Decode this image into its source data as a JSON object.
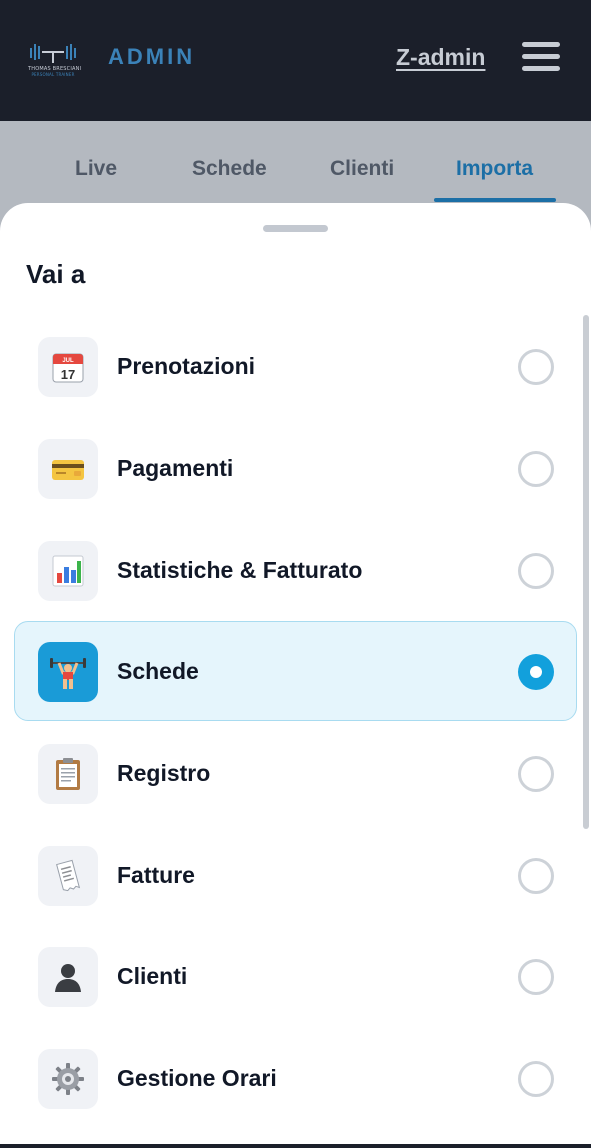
{
  "header": {
    "logo_text": "THOMAS BRESCIANI",
    "logo_subtext": "PERSONAL TRAINER",
    "title": "ADMIN",
    "user": "Z-admin",
    "menu_icon": "hamburger-menu-icon"
  },
  "tabs": [
    {
      "label": "Live",
      "active": false
    },
    {
      "label": "Schede",
      "active": false
    },
    {
      "label": "Clienti",
      "active": false
    },
    {
      "label": "Importa",
      "active": true
    }
  ],
  "sheet": {
    "title": "Vai a",
    "items": [
      {
        "label": "Prenotazioni",
        "icon": "calendar-icon",
        "selected": false
      },
      {
        "label": "Pagamenti",
        "icon": "credit-card-icon",
        "selected": false
      },
      {
        "label": "Statistiche & Fatturato",
        "icon": "bar-chart-icon",
        "selected": false
      },
      {
        "label": "Schede",
        "icon": "weightlifter-icon",
        "selected": true
      },
      {
        "label": "Registro",
        "icon": "clipboard-icon",
        "selected": false
      },
      {
        "label": "Fatture",
        "icon": "receipt-icon",
        "selected": false
      },
      {
        "label": "Clienti",
        "icon": "user-silhouette-icon",
        "selected": false
      },
      {
        "label": "Gestione Orari",
        "icon": "gear-icon",
        "selected": false
      }
    ]
  },
  "calendar_icon": {
    "month": "JUL",
    "day": "17"
  },
  "colors": {
    "header_bg": "#1b1f2a",
    "accent": "#1c6fa6",
    "selected_bg": "#e5f5fc",
    "radio_selected": "#12a0dc"
  }
}
